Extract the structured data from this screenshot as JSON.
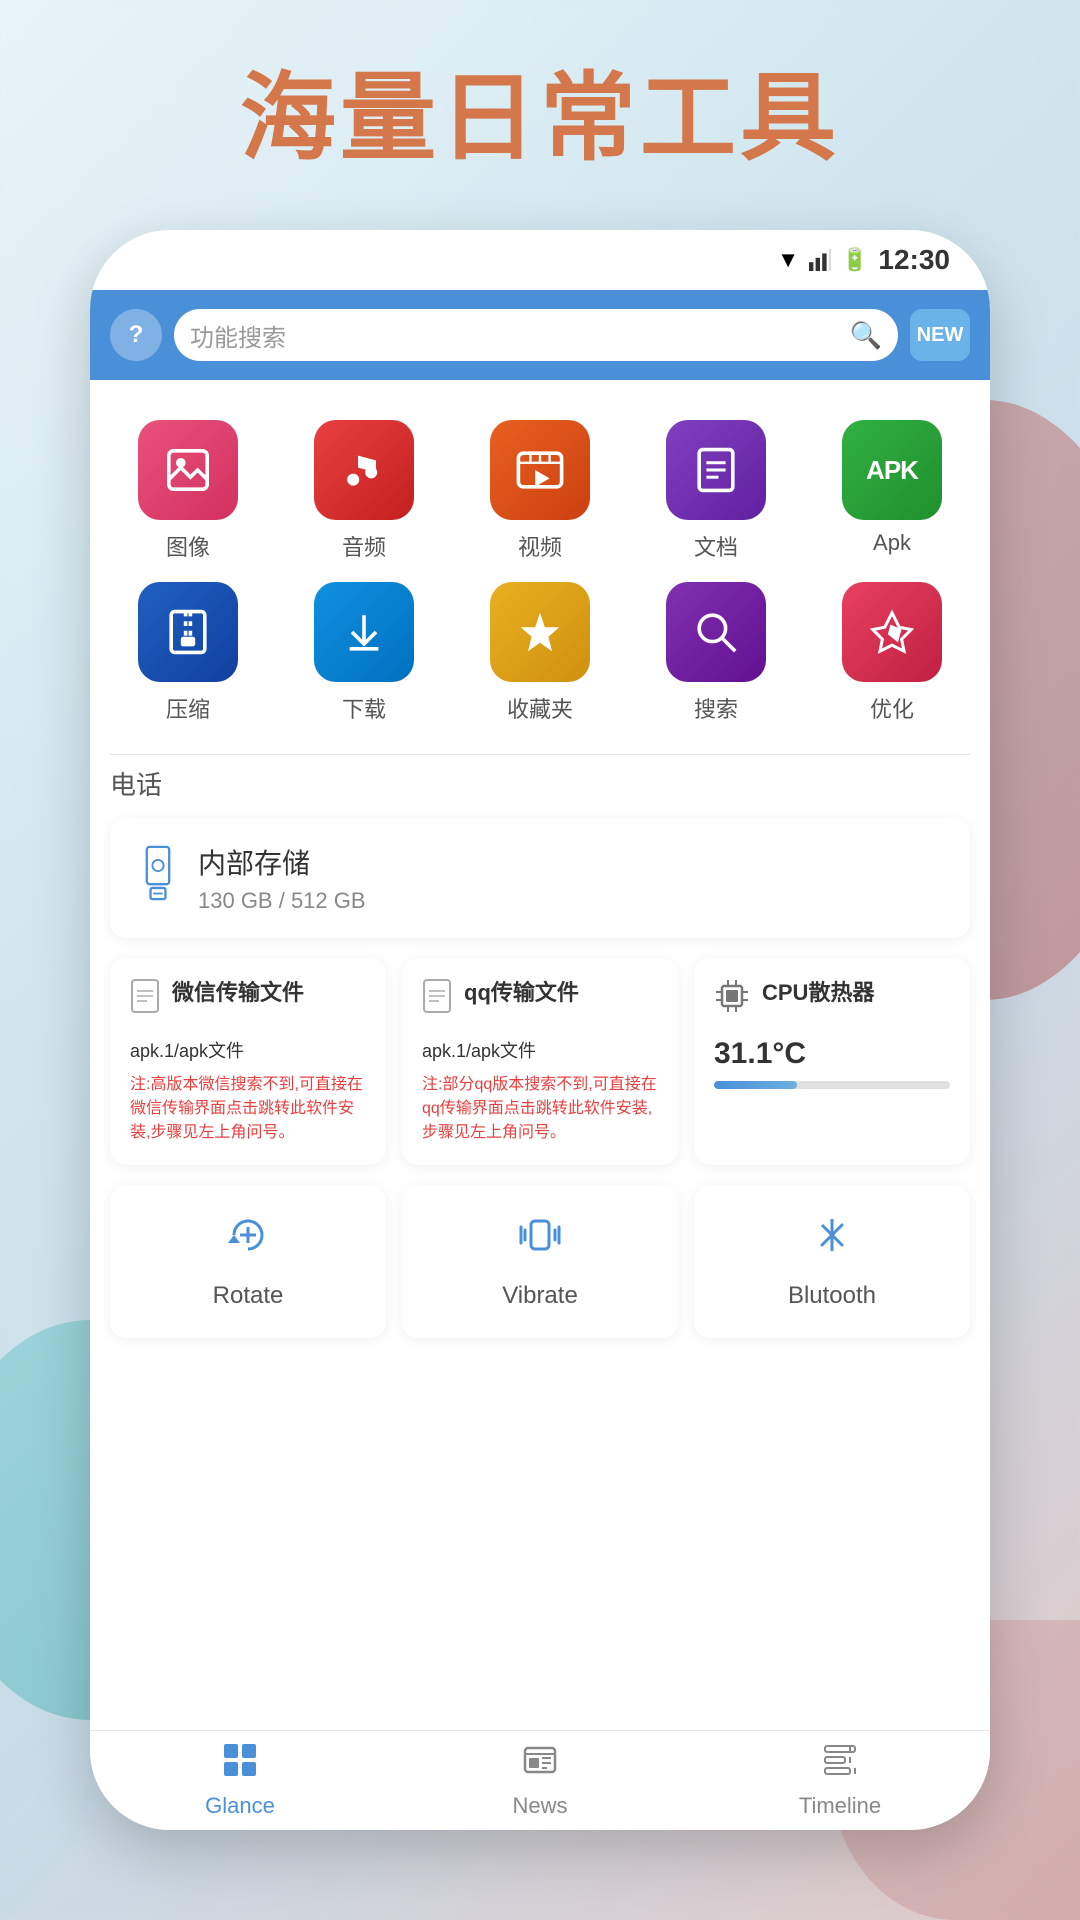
{
  "page": {
    "title": "海量日常工具",
    "background_gradient": "#e8f4f8"
  },
  "status_bar": {
    "time": "12:30"
  },
  "search_bar": {
    "placeholder": "功能搜索",
    "new_badge": "NEW"
  },
  "app_grid": {
    "row1": [
      {
        "icon": "🖼️",
        "label": "图像",
        "color_class": "img"
      },
      {
        "icon": "🎵",
        "label": "音频",
        "color_class": "audio"
      },
      {
        "icon": "▶",
        "label": "视频",
        "color_class": "video"
      },
      {
        "icon": "📄",
        "label": "文档",
        "color_class": "doc"
      },
      {
        "icon": "APK",
        "label": "Apk",
        "color_class": "apk"
      }
    ],
    "row2": [
      {
        "icon": "🗜",
        "label": "压缩",
        "color_class": "zip"
      },
      {
        "icon": "⬇",
        "label": "下载",
        "color_class": "download"
      },
      {
        "icon": "⭐",
        "label": "收藏夹",
        "color_class": "fav"
      },
      {
        "icon": "🔍",
        "label": "搜索",
        "color_class": "search"
      },
      {
        "icon": "🚀",
        "label": "优化",
        "color_class": "optimize"
      }
    ]
  },
  "phone_section": {
    "title": "电话",
    "storage": {
      "name": "内部存储",
      "used": "130 GB",
      "total": "512 GB",
      "display": "130 GB / 512 GB"
    }
  },
  "feature_cards": [
    {
      "title": "微信传输文件",
      "subtitle": "apk.1/apk文件",
      "note": "注:高版本微信搜索不到,可直接在微信传输界面点击跳转此软件安装,步骤见左上角问号。"
    },
    {
      "title": "qq传输文件",
      "subtitle": "apk.1/apk文件",
      "note": "注:部分qq版本搜索不到,可直接在qq传输界面点击跳转此软件安装,步骤见左上角问号。"
    },
    {
      "title": "CPU散热器",
      "temp": "31.1°C",
      "bar_percent": 35
    }
  ],
  "utility_cards": [
    {
      "icon": "rotate",
      "label": "Rotate"
    },
    {
      "icon": "vibrate",
      "label": "Vibrate"
    },
    {
      "icon": "bluetooth",
      "label": "Blutooth"
    }
  ],
  "bottom_nav": {
    "items": [
      {
        "icon": "grid",
        "label": "Glance",
        "active": true
      },
      {
        "icon": "news",
        "label": "News",
        "active": false
      },
      {
        "icon": "timeline",
        "label": "Timeline",
        "active": false
      }
    ]
  }
}
